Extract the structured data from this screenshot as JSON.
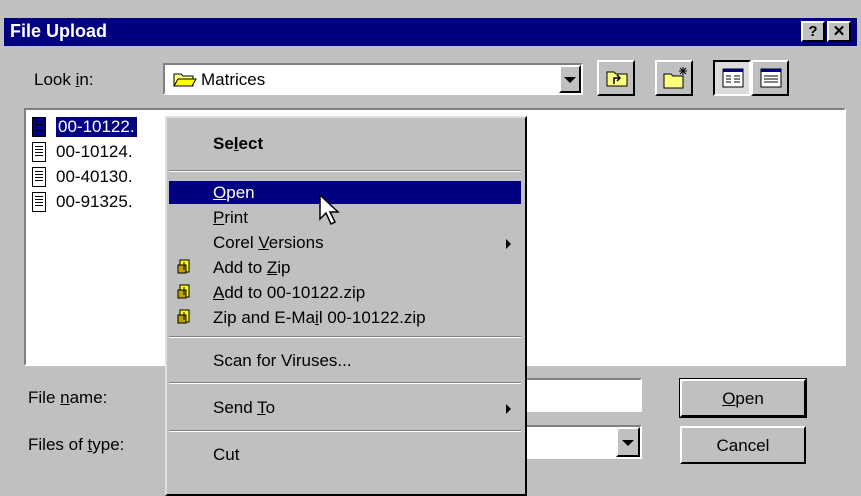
{
  "window": {
    "title": "File Upload",
    "help_btn": "?",
    "close_btn": "✕"
  },
  "lookin": {
    "label_pre": "Look ",
    "label_u": "i",
    "label_post": "n:",
    "value": "Matrices"
  },
  "files": [
    "00-10122.",
    "00-10124.",
    "00-40130.",
    "00-91325."
  ],
  "menu": {
    "select": {
      "pre": "Se",
      "u": "l",
      "post": "ect"
    },
    "open": {
      "pre": "",
      "u": "O",
      "post": "pen"
    },
    "print": {
      "pre": "",
      "u": "P",
      "post": "rint"
    },
    "corel": {
      "pre": "Corel ",
      "u": "V",
      "post": "ersions"
    },
    "addzip": {
      "pre": "Add to ",
      "u": "Z",
      "post": "ip"
    },
    "addnamed": {
      "pre": "",
      "u": "A",
      "post": "dd to 00-10122.zip"
    },
    "zipmail": {
      "pre": "Zip and E-Ma",
      "u": "i",
      "post": "l 00-10122.zip"
    },
    "scan": "Scan for Viruses...",
    "sendto": {
      "pre": "Send ",
      "u": "T",
      "post": "o"
    },
    "partial": "Cut"
  },
  "filename": {
    "pre": "File ",
    "u": "n",
    "post": "ame:"
  },
  "filetype": {
    "pre": "Files of ",
    "u": "t",
    "post": "ype:"
  },
  "buttons": {
    "open": {
      "u": "O",
      "post": "pen"
    },
    "cancel": "Cancel"
  },
  "colors": {
    "titlebar": "#000080",
    "face": "#c0c0c0",
    "highlight": "#000080"
  }
}
